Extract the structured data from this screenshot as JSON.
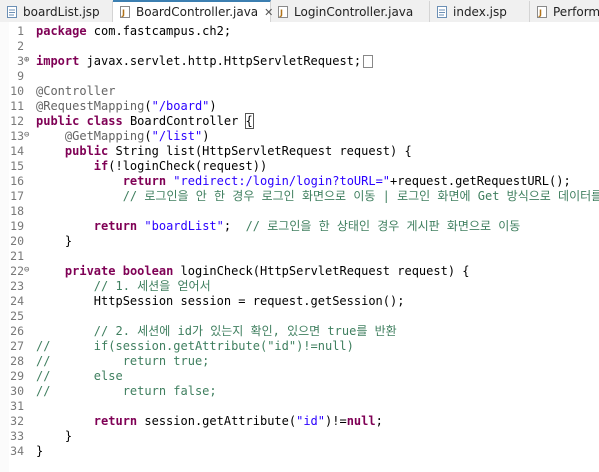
{
  "tabs": [
    {
      "label": "boardList.jsp",
      "icon": "jsp-file-icon",
      "active": false
    },
    {
      "label": "BoardController.java",
      "icon": "java-file-icon",
      "active": true,
      "close": "✕"
    },
    {
      "label": "LoginController.java",
      "icon": "java-file-icon",
      "active": false
    },
    {
      "label": "index.jsp",
      "icon": "jsp-file-icon",
      "active": false
    },
    {
      "label": "Performa",
      "icon": "java-file-icon",
      "active": false
    }
  ],
  "lines": [
    {
      "n": "1",
      "fold": "",
      "code": "package com.fastcampus.ch2;"
    },
    {
      "n": "2",
      "fold": "",
      "code": ""
    },
    {
      "n": "3",
      "fold": "⊕",
      "code": "import javax.servlet.http.HttpServletRequest;"
    },
    {
      "n": "9",
      "fold": "",
      "code": ""
    },
    {
      "n": "10",
      "fold": "",
      "code": "@Controller"
    },
    {
      "n": "11",
      "fold": "",
      "code": "@RequestMapping(\"/board\")"
    },
    {
      "n": "12",
      "fold": "",
      "code": "public class BoardController {"
    },
    {
      "n": "13",
      "fold": "⊖",
      "code": "    @GetMapping(\"/list\")"
    },
    {
      "n": "14",
      "fold": "",
      "code": "    public String list(HttpServletRequest request) {"
    },
    {
      "n": "15",
      "fold": "",
      "code": "        if(!loginCheck(request))"
    },
    {
      "n": "16",
      "fold": "",
      "code": "            return \"redirect:/login/login?toURL=\"+request.getRequestURL();"
    },
    {
      "n": "17",
      "fold": "",
      "code": "            // 로그인을 안 한 경우 로그인 화면으로 이동 | 로그인 화면에 Get 방식으로 데이터를 줌."
    },
    {
      "n": "18",
      "fold": "",
      "code": ""
    },
    {
      "n": "19",
      "fold": "",
      "code": "        return \"boardList\";  // 로그인을 한 상태인 경우 게시판 화면으로 이동"
    },
    {
      "n": "20",
      "fold": "",
      "code": "    }"
    },
    {
      "n": "21",
      "fold": "",
      "code": ""
    },
    {
      "n": "22",
      "fold": "⊖",
      "code": "    private boolean loginCheck(HttpServletRequest request) {"
    },
    {
      "n": "23",
      "fold": "",
      "code": "        // 1. 세션을 얻어서"
    },
    {
      "n": "24",
      "fold": "",
      "code": "        HttpSession session = request.getSession();"
    },
    {
      "n": "25",
      "fold": "",
      "code": ""
    },
    {
      "n": "26",
      "fold": "",
      "code": "        // 2. 세션에 id가 있는지 확인, 있으면 true를 반환"
    },
    {
      "n": "27",
      "fold": "",
      "code": "//      if(session.getAttribute(\"id\")!=null)"
    },
    {
      "n": "28",
      "fold": "",
      "code": "//          return true;"
    },
    {
      "n": "29",
      "fold": "",
      "code": "//      else"
    },
    {
      "n": "30",
      "fold": "",
      "code": "//          return false;"
    },
    {
      "n": "31",
      "fold": "",
      "code": ""
    },
    {
      "n": "32",
      "fold": "",
      "code": "        return session.getAttribute(\"id\")!=null;"
    },
    {
      "n": "33",
      "fold": "",
      "code": "    }"
    },
    {
      "n": "34",
      "fold": "",
      "code": "}"
    }
  ],
  "colors": {
    "keyword": "#7f0055",
    "string": "#2a00ff",
    "comment": "#3f7f5f",
    "annotation": "#646464"
  }
}
